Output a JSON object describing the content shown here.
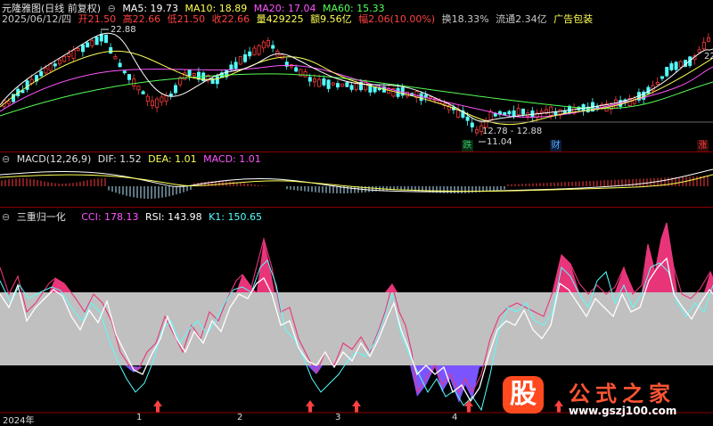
{
  "main": {
    "title": "元隆雅图(日线 前复权)",
    "ma": [
      {
        "label": "MA5: 19.73",
        "color": "#ffffff"
      },
      {
        "label": "MA10: 18.89",
        "color": "#ffff55"
      },
      {
        "label": "MA20: 17.04",
        "color": "#ff55ff"
      },
      {
        "label": "MA60: 15.33",
        "color": "#55ff55"
      }
    ],
    "quote": [
      {
        "text": "2025/06/12/四",
        "color": "#c8c8c8"
      },
      {
        "text": "开21.50",
        "color": "#ff4040"
      },
      {
        "text": "高22.66",
        "color": "#ff4040"
      },
      {
        "text": "低21.50",
        "color": "#ff4040"
      },
      {
        "text": "收22.66",
        "color": "#ff4040"
      },
      {
        "text": "量429225",
        "color": "#ffff55"
      },
      {
        "text": "额9.56亿",
        "color": "#ffff55"
      },
      {
        "text": "幅2.06(10.00%)",
        "color": "#ff4040"
      },
      {
        "text": "换18.33%",
        "color": "#c8c8c8"
      },
      {
        "text": "流通2.34亿",
        "color": "#c8c8c8"
      },
      {
        "text": "广告包装",
        "color": "#ffff55"
      }
    ],
    "high_label": "22.88",
    "low_label": "11.04",
    "range_label": "12.78 - 12.88",
    "right_label": "22",
    "tags": [
      {
        "text": "跌",
        "color": "#33cc66"
      },
      {
        "text": "财",
        "color": "#55aaff"
      },
      {
        "text": "涨",
        "color": "#ff4040"
      }
    ]
  },
  "macd": {
    "title": "MACD(12,26,9)",
    "dif": "DIF: 1.52",
    "dea": "DEA: 1.01",
    "macd": "MACD: 1.01"
  },
  "ind": {
    "title": "三重归一化",
    "cci": "CCI: 178.13",
    "rsi": "RSI: 143.98",
    "k1": "K1: 150.65"
  },
  "axis": {
    "labels": [
      "2024年",
      "1",
      "2",
      "3",
      "4"
    ]
  },
  "watermark": {
    "glyph": "股",
    "name": "公式之家",
    "url": "www.gszj100.com"
  },
  "colors": {
    "up": "#ff3c3c",
    "down": "#54ffff",
    "pink": "#e8357a",
    "purple": "#7a55ff",
    "band": "#c0c0c0"
  }
}
